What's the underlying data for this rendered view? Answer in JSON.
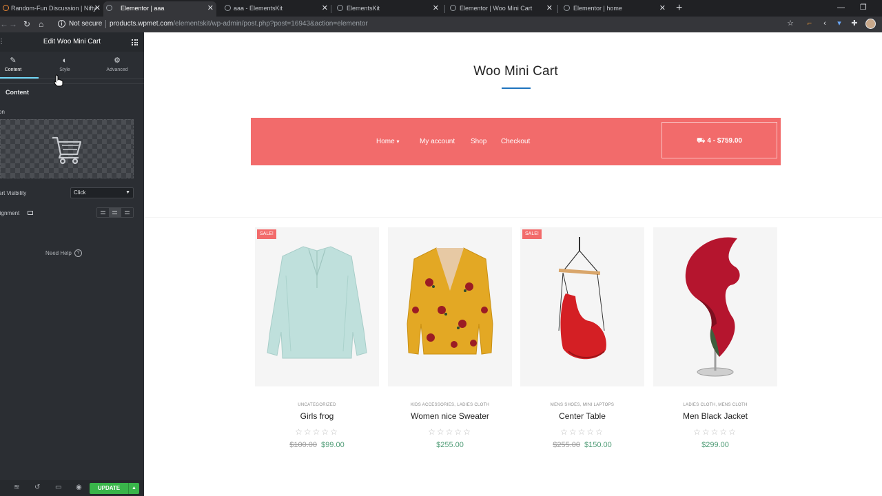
{
  "browser": {
    "tabs": [
      {
        "title": "Random-Fun Discussion | Nifty",
        "active": false
      },
      {
        "title": "Elementor | aaa",
        "active": true
      },
      {
        "title": "aaa - ElementsKit",
        "active": false
      },
      {
        "title": "ElementsKit",
        "active": false
      },
      {
        "title": "Elementor | Woo Mini Cart",
        "active": false
      },
      {
        "title": "Elementor | home",
        "active": false
      }
    ],
    "security_label": "Not secure",
    "url_host": "products.wpmet.com",
    "url_path": "/elementskit/wp-admin/post.php?post=16943&action=elementor"
  },
  "panel": {
    "title": "Edit Woo Mini Cart",
    "tabs": [
      {
        "label": "Content",
        "icon": "pencil-icon"
      },
      {
        "label": "Style",
        "icon": "half-circle-icon"
      },
      {
        "label": "Advanced",
        "icon": "gear-icon"
      }
    ],
    "section_title": "Content",
    "icon_label": "on",
    "cart_visibility_label": "art Visibility",
    "cart_visibility_value": "Click",
    "alignment_label": "lignment",
    "need_help": "Need Help",
    "update_label": "UPDATE"
  },
  "preview": {
    "heading": "Woo Mini Cart",
    "menu": [
      {
        "label": "Home",
        "has_dropdown": true
      },
      {
        "label": "My account",
        "has_dropdown": false
      },
      {
        "label": "Shop",
        "has_dropdown": false
      },
      {
        "label": "Checkout",
        "has_dropdown": false
      }
    ],
    "mini_cart": "4 - $759.00",
    "accent_color": "#f26b6b",
    "title_underline_color": "#1e73be",
    "products": [
      {
        "name": "Girls frog",
        "category": "UNCATEGORIZED",
        "sale": true,
        "sale_label": "SALE!",
        "old_price": "$100.00",
        "price": "$99.00",
        "image": "light-blouse"
      },
      {
        "name": "Women nice Sweater",
        "category": "KIDS ACCESSORIES, LADIES CLOTH",
        "sale": false,
        "sale_label": "",
        "old_price": "",
        "price": "$255.00",
        "image": "yellow-floral-blouse"
      },
      {
        "name": "Center Table",
        "category": "MENS SHOES, MINI LAPTOPS",
        "sale": true,
        "sale_label": "SALE!",
        "old_price": "$255.00",
        "price": "$150.00",
        "image": "red-hanging-chair"
      },
      {
        "name": "Men Black Jacket",
        "category": "LADIES CLOTH, MENS CLOTH",
        "sale": false,
        "sale_label": "",
        "old_price": "",
        "price": "$299.00",
        "image": "red-sculpture"
      }
    ],
    "rating_stars": "☆☆☆☆☆"
  }
}
